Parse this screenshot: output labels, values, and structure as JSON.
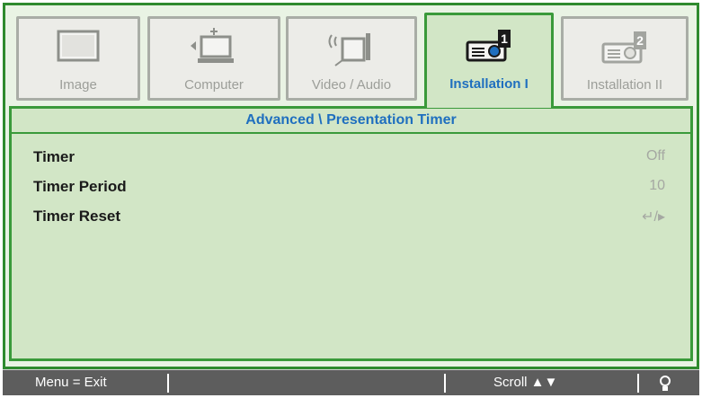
{
  "tabs": [
    {
      "label": "Image",
      "icon": "monitor-icon",
      "active": false
    },
    {
      "label": "Computer",
      "icon": "computer-icon",
      "active": false
    },
    {
      "label": "Video / Audio",
      "icon": "video-audio-icon",
      "active": false
    },
    {
      "label": "Installation I",
      "icon": "projector-1-icon",
      "active": true
    },
    {
      "label": "Installation II",
      "icon": "projector-2-icon",
      "active": false
    }
  ],
  "panel": {
    "title": "Advanced \\ Presentation Timer",
    "rows": [
      {
        "name": "Timer",
        "value": "Off"
      },
      {
        "name": "Timer Period",
        "value": "10"
      },
      {
        "name": "Timer Reset",
        "value": "↵/▸"
      }
    ]
  },
  "status": {
    "left": "Menu = Exit",
    "scroll": "Scroll ▲▼",
    "right_icon": "bulb-icon"
  },
  "colors": {
    "frame_green": "#2e8a2e",
    "panel_bg": "#d2e6c6",
    "active_label": "#1f6fbf",
    "status_bg": "#5d5d5d"
  }
}
